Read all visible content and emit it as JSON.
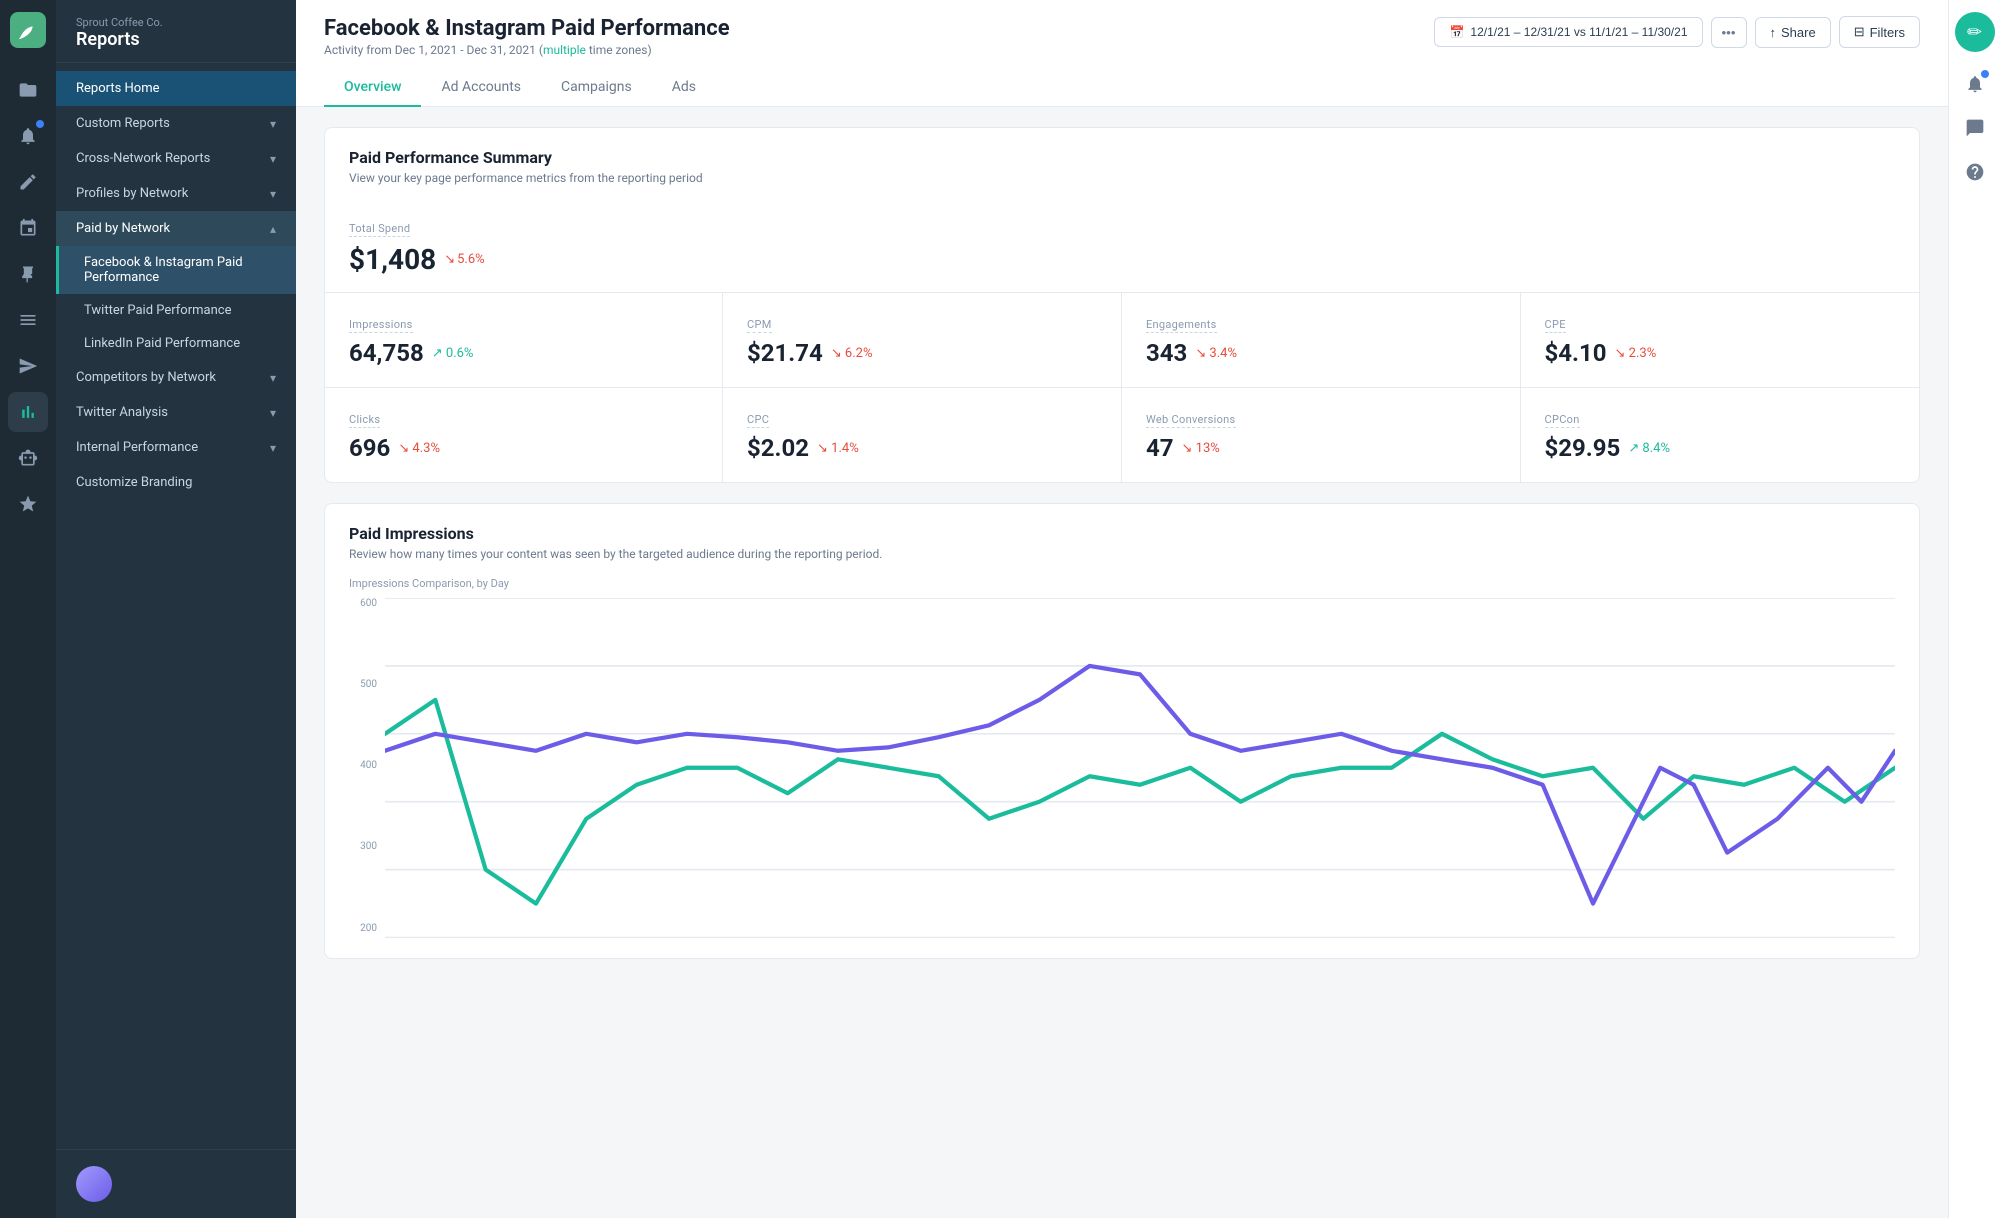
{
  "company": "Sprout Coffee Co.",
  "app_title": "Reports",
  "page_title": "Facebook & Instagram Paid Performance",
  "page_subtitle": "Activity from Dec 1, 2021 - Dec 31, 2021",
  "page_subtitle_link": "multiple",
  "page_subtitle_suffix": " time zones)",
  "date_range": "12/1/21 – 12/31/21 vs 11/1/21 – 11/30/21",
  "tabs": [
    "Overview",
    "Ad Accounts",
    "Campaigns",
    "Ads"
  ],
  "active_tab": "Overview",
  "buttons": {
    "share": "Share",
    "filters": "Filters"
  },
  "sidebar": {
    "items": [
      {
        "id": "reports-home",
        "label": "Reports Home",
        "active": true,
        "has_children": false
      },
      {
        "id": "custom-reports",
        "label": "Custom Reports",
        "has_children": true,
        "expanded": false
      },
      {
        "id": "cross-network",
        "label": "Cross-Network Reports",
        "has_children": true,
        "expanded": false
      },
      {
        "id": "profiles-by-network",
        "label": "Profiles by Network",
        "has_children": true,
        "expanded": false
      },
      {
        "id": "paid-by-network",
        "label": "Paid by Network",
        "has_children": true,
        "expanded": true
      },
      {
        "id": "fb-instagram-paid",
        "label": "Facebook & Instagram Paid Performance",
        "is_subitem": true,
        "active": true
      },
      {
        "id": "twitter-paid",
        "label": "Twitter Paid Performance",
        "is_subitem": true
      },
      {
        "id": "linkedin-paid",
        "label": "LinkedIn Paid Performance",
        "is_subitem": true
      },
      {
        "id": "competitors-by-network",
        "label": "Competitors by Network",
        "has_children": true,
        "expanded": false
      },
      {
        "id": "twitter-analysis",
        "label": "Twitter Analysis",
        "has_children": true,
        "expanded": false
      },
      {
        "id": "internal-performance",
        "label": "Internal Performance",
        "has_children": true,
        "expanded": false
      },
      {
        "id": "customize-branding",
        "label": "Customize Branding",
        "has_children": false
      }
    ]
  },
  "summary": {
    "section_title": "Paid Performance Summary",
    "section_subtitle": "View your key page performance metrics from the reporting period",
    "total_spend_label": "Total Spend",
    "total_spend_value": "$1,408",
    "total_spend_change": "5.6%",
    "total_spend_direction": "down",
    "metrics": [
      {
        "col": 0,
        "rows": [
          [
            {
              "label": "Impressions",
              "value": "64,758",
              "change": "0.6%",
              "direction": "up"
            },
            {
              "label": "CPM",
              "value": "$21.74",
              "change": "6.2%",
              "direction": "down"
            }
          ],
          [
            {
              "label": "Clicks",
              "value": "696",
              "change": "4.3%",
              "direction": "down"
            },
            {
              "label": "CPC",
              "value": "$2.02",
              "change": "1.4%",
              "direction": "down"
            }
          ]
        ]
      },
      {
        "col": 1,
        "rows": [
          [
            {
              "label": "Engagements",
              "value": "343",
              "change": "3.4%",
              "direction": "down"
            },
            {
              "label": "CPE",
              "value": "$4.10",
              "change": "2.3%",
              "direction": "down"
            }
          ],
          [
            {
              "label": "Web Conversions",
              "value": "47",
              "change": "13%",
              "direction": "down"
            },
            {
              "label": "CPCon",
              "value": "$29.95",
              "change": "8.4%",
              "direction": "up"
            }
          ]
        ]
      }
    ]
  },
  "impressions_chart": {
    "title": "Paid Impressions",
    "subtitle": "Review how many times your content was seen by the targeted audience during the reporting period.",
    "comparison_label": "Impressions Comparison, by Day",
    "y_labels": [
      "600",
      "500",
      "400",
      "300",
      "200"
    ],
    "lines": {
      "current": {
        "color": "#1abc9c"
      },
      "previous": {
        "color": "#6c5ce7"
      }
    }
  },
  "rail_icons": [
    "📁",
    "🔔",
    "💬",
    "❓"
  ],
  "right_icons": [
    "✏️",
    "🔔",
    "💬",
    "❓"
  ]
}
